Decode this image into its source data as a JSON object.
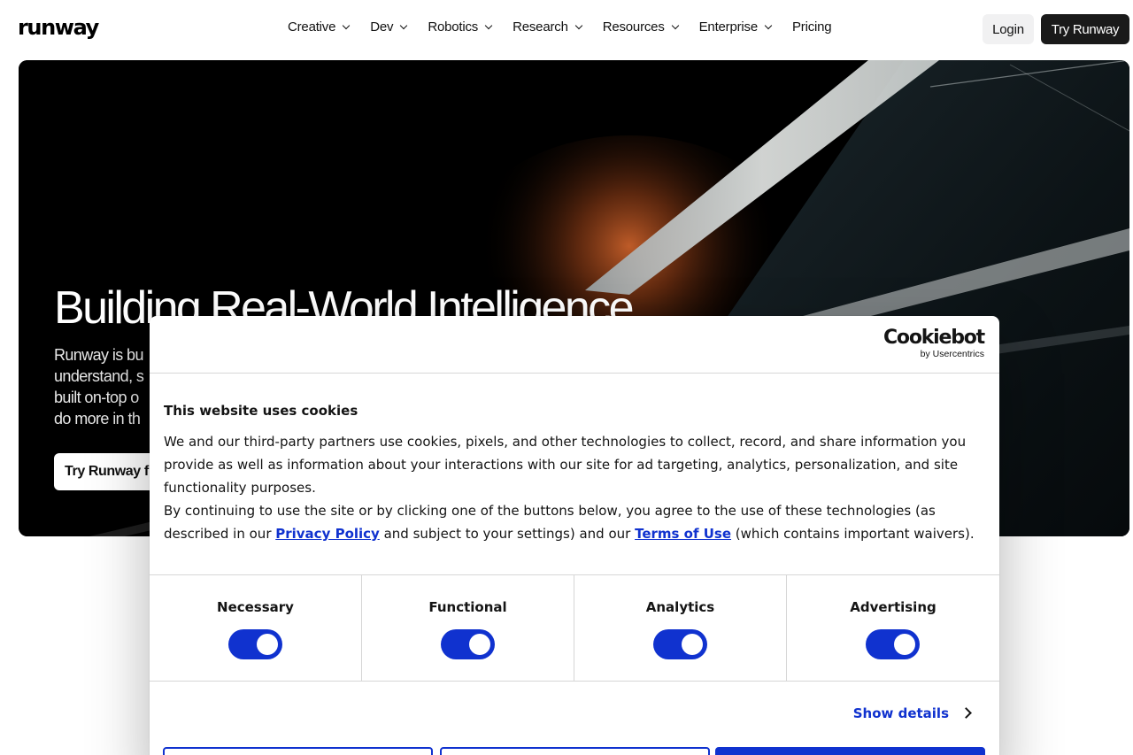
{
  "brand": {
    "logo_text": "runway"
  },
  "nav": {
    "items": [
      {
        "label": "Creative",
        "has_dropdown": true
      },
      {
        "label": "Dev",
        "has_dropdown": true
      },
      {
        "label": "Robotics",
        "has_dropdown": true
      },
      {
        "label": "Research",
        "has_dropdown": true
      },
      {
        "label": "Resources",
        "has_dropdown": true
      },
      {
        "label": "Enterprise",
        "has_dropdown": true
      },
      {
        "label": "Pricing",
        "has_dropdown": false
      }
    ],
    "login_label": "Login",
    "try_label": "Try Runway"
  },
  "hero": {
    "title": "Building Real-World Intelligence",
    "subtitle_lines": [
      "Runway is bu",
      "understand, s",
      "built on-top o",
      "do more in th"
    ],
    "cta_label": "Try Runway f"
  },
  "cookie_dialog": {
    "provider_logo": "Cookiebot",
    "provider_byline": "by Usercentrics",
    "title": "This website uses cookies",
    "paragraph1": "We and our third-party partners use cookies, pixels, and other technologies to collect, record, and share information you provide as well as information about your interactions with our site for ad targeting, analytics, personalization, and site functionality purposes.",
    "paragraph2_prefix": "By continuing to use the site or by clicking one of the buttons below, you agree to the use of these technologies (as described in our ",
    "privacy_link": "Privacy Policy",
    "paragraph2_middle": " and subject to your settings) and our ",
    "terms_link": "Terms of Use",
    "paragraph2_suffix": " (which contains important waivers).",
    "categories": [
      {
        "label": "Necessary",
        "enabled": true
      },
      {
        "label": "Functional",
        "enabled": true
      },
      {
        "label": "Analytics",
        "enabled": true
      },
      {
        "label": "Advertising",
        "enabled": true
      }
    ],
    "show_details_label": "Show details",
    "toggle_color": "#1032cf"
  }
}
